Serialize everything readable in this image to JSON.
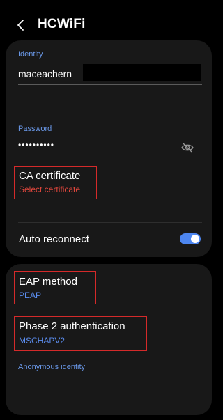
{
  "header": {
    "title": "HCWiFi",
    "back_icon": "chevron-left-icon"
  },
  "identity": {
    "label": "Identity",
    "value": "maceachern"
  },
  "password": {
    "label": "Password",
    "value": "••••••••••",
    "visibility_icon": "eye-off-icon"
  },
  "ca_certificate": {
    "title": "CA certificate",
    "subtitle": "Select certificate"
  },
  "auto_reconnect": {
    "label": "Auto reconnect",
    "enabled": true
  },
  "eap_method": {
    "title": "EAP method",
    "value": "PEAP"
  },
  "phase2": {
    "title": "Phase 2 authentication",
    "value": "MSCHAPV2"
  },
  "anonymous_identity": {
    "label": "Anonymous identity",
    "value": ""
  },
  "colors": {
    "background": "#000000",
    "card": "#181818",
    "accent_blue": "#6a98e8",
    "link_blue": "#5b8def",
    "error_red": "#e0463c",
    "highlight_red": "#d42a2a",
    "toggle_on": "#4d86f0"
  }
}
